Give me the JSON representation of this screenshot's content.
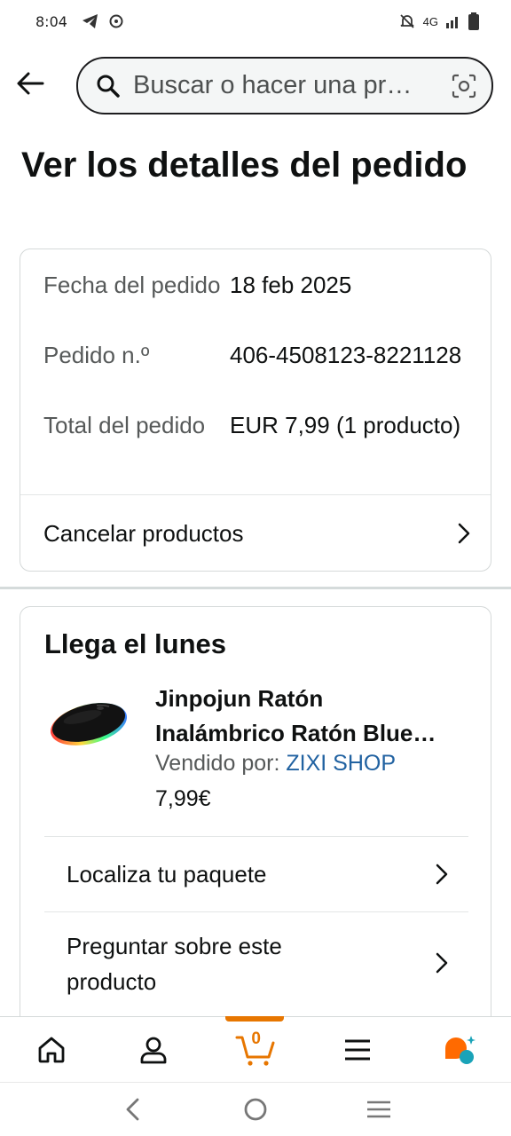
{
  "status_bar": {
    "time": "8:04",
    "network": "4G"
  },
  "header": {
    "search_placeholder": "Buscar o hacer una pr…"
  },
  "page": {
    "title": "Ver los detalles del pedido"
  },
  "order_summary": {
    "rows": [
      {
        "label": "Fecha del pedido",
        "value": "18 feb 2025"
      },
      {
        "label": "Pedido n.º",
        "value": "406-4508123-8221128"
      },
      {
        "label": "Total del pedido",
        "value": "EUR 7,99 (1 producto)"
      }
    ],
    "cancel_label": "Cancelar productos"
  },
  "delivery": {
    "title": "Llega el lunes",
    "product": {
      "title_line1": "Jinpojun Ratón",
      "title_line2": "Inalámbrico Ratón Blue…",
      "seller_label": "Vendido por:",
      "seller_name": "ZIXI SHOP",
      "price": "7,99€"
    },
    "actions": [
      {
        "label": "Localiza tu paquete"
      },
      {
        "label": "Preguntar sobre este producto"
      }
    ]
  },
  "bottom_nav": {
    "items": [
      {
        "name": "home",
        "icon": "home-icon"
      },
      {
        "name": "account",
        "icon": "person-icon"
      },
      {
        "name": "cart",
        "icon": "cart-icon",
        "count": "0",
        "active": true
      },
      {
        "name": "menu",
        "icon": "hamburger-icon"
      },
      {
        "name": "rufus",
        "icon": "chat-assistant-icon"
      }
    ]
  },
  "colors": {
    "accent": "#e77600",
    "link": "#2162a1",
    "text": "#0f1111",
    "muted": "#565959"
  }
}
